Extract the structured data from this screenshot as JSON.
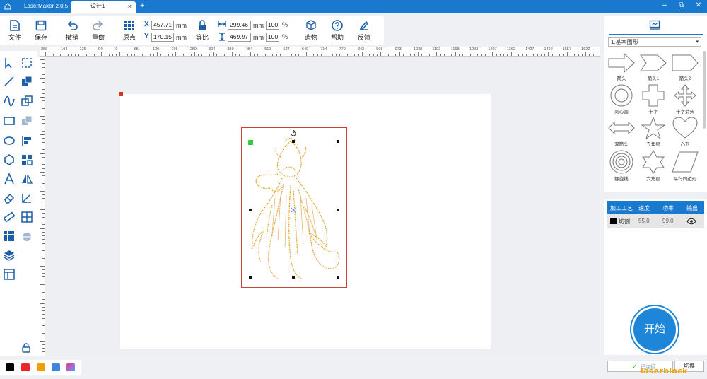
{
  "titlebar": {
    "app_tab": "LaserMaker 2.0.5",
    "doc_tab": "设计1",
    "tab_close": "×",
    "add_tab": "+",
    "minimize": "–",
    "restore": "⧉",
    "close": "✕"
  },
  "toolbar": {
    "file": "文件",
    "save": "保存",
    "undo": "撤销",
    "redo": "重做",
    "origin": "原点",
    "x_label": "X",
    "x_value": "457.71",
    "y_label": "Y",
    "y_value": "170.15",
    "mm": "mm",
    "lock_label": "等比",
    "width_value": "299.46",
    "height_value": "469.97",
    "width_pct": "100",
    "height_pct": "100",
    "pct": "%",
    "create": "造物",
    "help": "帮助",
    "feedback": "反馈"
  },
  "ruler_ticks": [
    "258",
    "194",
    "129",
    "64",
    "0",
    "65",
    "130",
    "195",
    "259",
    "324",
    "389",
    "454",
    "519",
    "584",
    "649",
    "714",
    "779",
    "843",
    "908",
    "973",
    "1038",
    "1103",
    "1168",
    "1233",
    "1297",
    "1362",
    "1427",
    "1492",
    "1557",
    "1622",
    "16"
  ],
  "ruler_prefix": "-",
  "colors": {
    "palette": [
      "#000000",
      "#e8262b",
      "#f0a000",
      "#3f86e0",
      "gradient"
    ],
    "accent": "#1979cf",
    "engrave_line": "#e69a1e"
  },
  "shape_panel": {
    "category": "1.基本图形",
    "shapes": [
      {
        "label": "箭头",
        "icon": "arrow-right-icon"
      },
      {
        "label": "箭头1",
        "icon": "arrow-right-notch-icon"
      },
      {
        "label": "箭头2",
        "icon": "chevron-arrow-icon"
      },
      {
        "label": "同心圆",
        "icon": "concentric-circle-icon"
      },
      {
        "label": "十字",
        "icon": "cross-icon"
      },
      {
        "label": "十字箭头",
        "icon": "cross-arrows-icon"
      },
      {
        "label": "双箭头",
        "icon": "double-arrow-icon"
      },
      {
        "label": "五角星",
        "icon": "star5-icon"
      },
      {
        "label": "心形",
        "icon": "heart-icon"
      },
      {
        "label": "螺旋线",
        "icon": "spiral-icon"
      },
      {
        "label": "六角星",
        "icon": "star6-icon"
      },
      {
        "label": "平行四边形",
        "icon": "parallelogram-icon"
      }
    ]
  },
  "process_panel": {
    "headers": [
      "加工工艺",
      "速度",
      "功率",
      "输出"
    ],
    "rows": [
      {
        "mode": "切割",
        "speed": "55.0",
        "power": "99.0"
      }
    ]
  },
  "start_button": "开始",
  "connect_status": "已连接",
  "switch_button": "切换",
  "watermark": "laserblock"
}
